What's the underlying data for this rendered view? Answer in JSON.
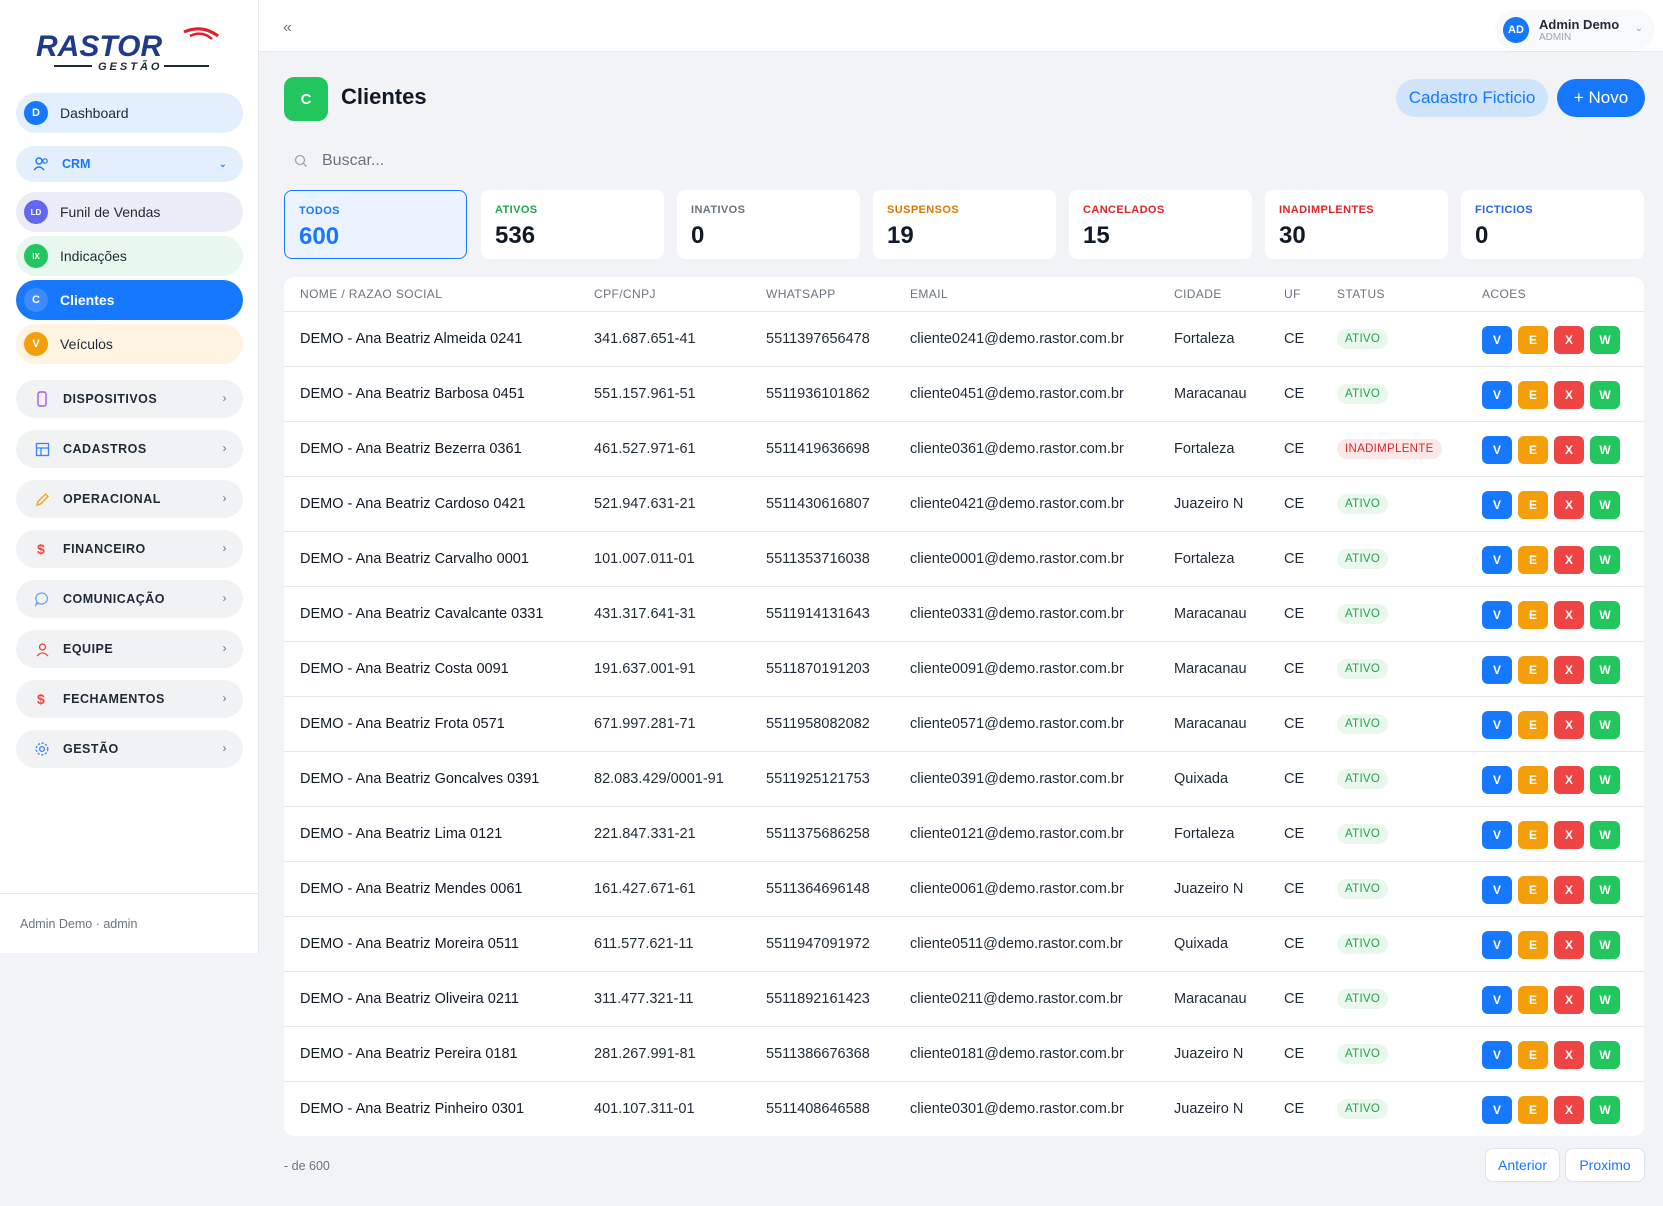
{
  "brand": {
    "logo_text": "RASTOR",
    "logo_sub": "GESTÃO"
  },
  "sidebar": {
    "items": [
      {
        "badge": "D",
        "label": "Dashboard",
        "bg": "#e3effd",
        "badge_color": "#1677ff"
      },
      {
        "badge": "LD",
        "label": "Funil de Vendas",
        "bg": "#ececf9",
        "badge_color": "#6366f1"
      },
      {
        "badge": "IX",
        "label": "Indicações",
        "bg": "#e8f8ee",
        "badge_color": "#22c55e"
      },
      {
        "badge": "C",
        "label": "Clientes",
        "bg": "#1677ff",
        "badge_color": "#3d8bff"
      },
      {
        "badge": "V",
        "label": "Veículos",
        "bg": "#fff3e2",
        "badge_color": "#f59e0b"
      }
    ],
    "crm": {
      "label": "CRM",
      "icon": "users-icon"
    },
    "groups": [
      {
        "label": "DISPOSITIVOS",
        "icon": "device-icon"
      },
      {
        "label": "CADASTROS",
        "icon": "grid-icon"
      },
      {
        "label": "OPERACIONAL",
        "icon": "pencil-icon"
      },
      {
        "label": "FINANCEIRO",
        "icon": "dollar-icon"
      },
      {
        "label": "COMUNICAÇÃO",
        "icon": "chat-icon"
      },
      {
        "label": "EQUIPE",
        "icon": "user-icon"
      },
      {
        "label": "FECHAMENTOS",
        "icon": "dollar-icon"
      },
      {
        "label": "GESTÃO",
        "icon": "gear-icon"
      }
    ],
    "footer": "Admin Demo · admin"
  },
  "topbar": {
    "collapse": "«",
    "user_initials": "AD",
    "user_name": "Admin Demo",
    "user_role": "ADMIN"
  },
  "page": {
    "icon_letter": "C",
    "title": "Clientes",
    "btn_ficticio": "Cadastro Ficticio",
    "btn_novo": "+ Novo"
  },
  "search": {
    "placeholder": "Buscar..."
  },
  "stats": [
    {
      "label": "TODOS",
      "value": "600",
      "color": "#1677ff"
    },
    {
      "label": "ATIVOS",
      "value": "536",
      "color": "#22a34a"
    },
    {
      "label": "INATIVOS",
      "value": "0",
      "color": "#6b7280"
    },
    {
      "label": "SUSPENSOS",
      "value": "19",
      "color": "#d97706"
    },
    {
      "label": "CANCELADOS",
      "value": "15",
      "color": "#dc2626"
    },
    {
      "label": "INADIMPLENTES",
      "value": "30",
      "color": "#dc2626"
    },
    {
      "label": "FICTICIOS",
      "value": "0",
      "color": "#2563eb"
    }
  ],
  "table": {
    "headers": [
      "NOME / RAZAO SOCIAL",
      "CPF/CNPJ",
      "WHATSAPP",
      "EMAIL",
      "CIDADE",
      "UF",
      "STATUS",
      "ACOES"
    ],
    "actions": [
      "V",
      "E",
      "X",
      "W"
    ],
    "rows": [
      {
        "name": "DEMO - Ana Beatriz Almeida 0241",
        "doc": "341.687.651-41",
        "whats": "5511397656478",
        "email": "cliente0241@demo.rastor.com.br",
        "city": "Fortaleza",
        "uf": "CE",
        "status": "ATIVO"
      },
      {
        "name": "DEMO - Ana Beatriz Barbosa 0451",
        "doc": "551.157.961-51",
        "whats": "5511936101862",
        "email": "cliente0451@demo.rastor.com.br",
        "city": "Maracanau",
        "uf": "CE",
        "status": "ATIVO"
      },
      {
        "name": "DEMO - Ana Beatriz Bezerra 0361",
        "doc": "461.527.971-61",
        "whats": "5511419636698",
        "email": "cliente0361@demo.rastor.com.br",
        "city": "Fortaleza",
        "uf": "CE",
        "status": "INADIMPLENTE"
      },
      {
        "name": "DEMO - Ana Beatriz Cardoso 0421",
        "doc": "521.947.631-21",
        "whats": "5511430616807",
        "email": "cliente0421@demo.rastor.com.br",
        "city": "Juazeiro N",
        "uf": "CE",
        "status": "ATIVO"
      },
      {
        "name": "DEMO - Ana Beatriz Carvalho 0001",
        "doc": "101.007.011-01",
        "whats": "5511353716038",
        "email": "cliente0001@demo.rastor.com.br",
        "city": "Fortaleza",
        "uf": "CE",
        "status": "ATIVO"
      },
      {
        "name": "DEMO - Ana Beatriz Cavalcante 0331",
        "doc": "431.317.641-31",
        "whats": "5511914131643",
        "email": "cliente0331@demo.rastor.com.br",
        "city": "Maracanau",
        "uf": "CE",
        "status": "ATIVO"
      },
      {
        "name": "DEMO - Ana Beatriz Costa 0091",
        "doc": "191.637.001-91",
        "whats": "5511870191203",
        "email": "cliente0091@demo.rastor.com.br",
        "city": "Maracanau",
        "uf": "CE",
        "status": "ATIVO"
      },
      {
        "name": "DEMO - Ana Beatriz Frota 0571",
        "doc": "671.997.281-71",
        "whats": "5511958082082",
        "email": "cliente0571@demo.rastor.com.br",
        "city": "Maracanau",
        "uf": "CE",
        "status": "ATIVO"
      },
      {
        "name": "DEMO - Ana Beatriz Goncalves 0391",
        "doc": "82.083.429/0001-91",
        "whats": "5511925121753",
        "email": "cliente0391@demo.rastor.com.br",
        "city": "Quixada",
        "uf": "CE",
        "status": "ATIVO"
      },
      {
        "name": "DEMO - Ana Beatriz Lima 0121",
        "doc": "221.847.331-21",
        "whats": "5511375686258",
        "email": "cliente0121@demo.rastor.com.br",
        "city": "Fortaleza",
        "uf": "CE",
        "status": "ATIVO"
      },
      {
        "name": "DEMO - Ana Beatriz Mendes 0061",
        "doc": "161.427.671-61",
        "whats": "5511364696148",
        "email": "cliente0061@demo.rastor.com.br",
        "city": "Juazeiro N",
        "uf": "CE",
        "status": "ATIVO"
      },
      {
        "name": "DEMO - Ana Beatriz Moreira 0511",
        "doc": "611.577.621-11",
        "whats": "5511947091972",
        "email": "cliente0511@demo.rastor.com.br",
        "city": "Quixada",
        "uf": "CE",
        "status": "ATIVO"
      },
      {
        "name": "DEMO - Ana Beatriz Oliveira 0211",
        "doc": "311.477.321-11",
        "whats": "5511892161423",
        "email": "cliente0211@demo.rastor.com.br",
        "city": "Maracanau",
        "uf": "CE",
        "status": "ATIVO"
      },
      {
        "name": "DEMO - Ana Beatriz Pereira 0181",
        "doc": "281.267.991-81",
        "whats": "5511386676368",
        "email": "cliente0181@demo.rastor.com.br",
        "city": "Juazeiro N",
        "uf": "CE",
        "status": "ATIVO"
      },
      {
        "name": "DEMO - Ana Beatriz Pinheiro 0301",
        "doc": "401.107.311-01",
        "whats": "5511408646588",
        "email": "cliente0301@demo.rastor.com.br",
        "city": "Juazeiro N",
        "uf": "CE",
        "status": "ATIVO"
      }
    ]
  },
  "pager": {
    "info": "- de 600",
    "prev": "Anterior",
    "next": "Proximo"
  }
}
